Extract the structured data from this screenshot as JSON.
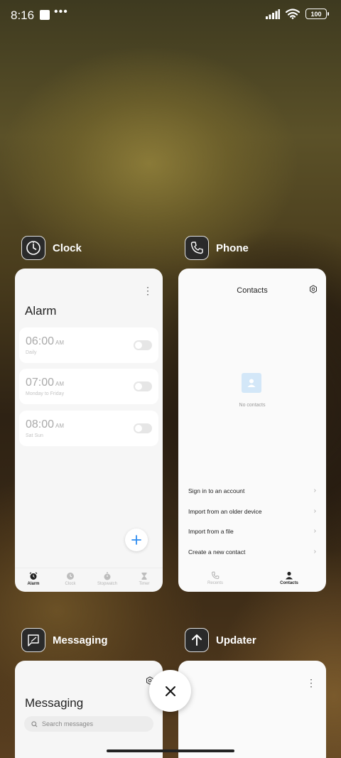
{
  "status_bar": {
    "time": "8:16",
    "dots": "•••",
    "battery": "100"
  },
  "cards": {
    "clock": {
      "app_name": "Clock",
      "screen_title": "Alarm",
      "alarms": [
        {
          "time": "06:00",
          "ampm": "AM",
          "repeat": "Daily"
        },
        {
          "time": "07:00",
          "ampm": "AM",
          "repeat": "Monday to Friday"
        },
        {
          "time": "08:00",
          "ampm": "AM",
          "repeat": "Sat Sun"
        }
      ],
      "tabs": [
        "Alarm",
        "Clock",
        "Stopwatch",
        "Timer"
      ],
      "active_tab": "Alarm"
    },
    "phone": {
      "app_name": "Phone",
      "screen_title": "Contacts",
      "empty_text": "No contacts",
      "menu": [
        "Sign in to an account",
        "Import from an older device",
        "Import from a file",
        "Create a new contact"
      ],
      "tabs": [
        "Recents",
        "Contacts"
      ],
      "active_tab": "Contacts"
    },
    "messaging": {
      "app_name": "Messaging",
      "screen_title": "Messaging",
      "search_placeholder": "Search messages"
    },
    "updater": {
      "app_name": "Updater"
    }
  },
  "colors": {
    "accent": "#2e8cf0"
  }
}
